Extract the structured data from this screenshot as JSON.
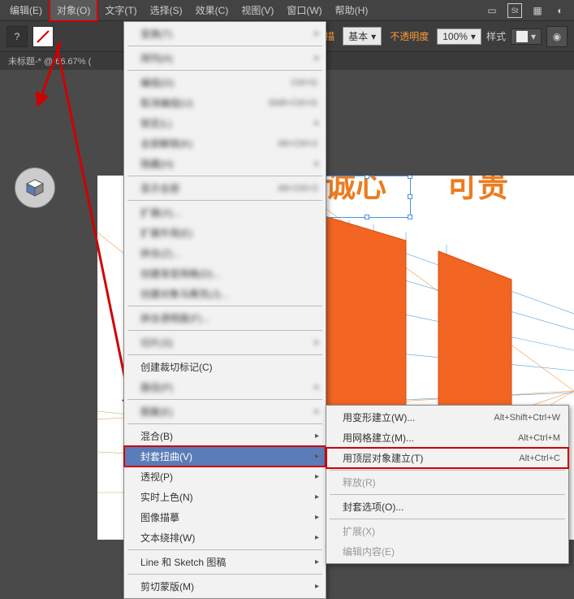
{
  "menubar": {
    "items": [
      {
        "label": "编辑(E)"
      },
      {
        "label": "对象(O)"
      },
      {
        "label": "文字(T)"
      },
      {
        "label": "选择(S)"
      },
      {
        "label": "效果(C)"
      },
      {
        "label": "视图(V)"
      },
      {
        "label": "窗口(W)"
      },
      {
        "label": "帮助(H)"
      }
    ]
  },
  "toolbar": {
    "stroke_label": "描",
    "basic_label": "基本",
    "opacity_label": "不透明度",
    "opacity_value": "100%",
    "style_label": "样式"
  },
  "doc": {
    "title": "未标题-* @ 66.67%  ("
  },
  "canvas_text": {
    "t1": "诚心",
    "t2": "可贵"
  },
  "dropdown": {
    "items": [
      {
        "label": "变换(T)",
        "sub": true,
        "blur": true
      },
      {
        "label": "排列(A)",
        "sub": true,
        "blur": true
      },
      {
        "label": "编组(G)",
        "shortcut": "Ctrl+G",
        "blur": true
      },
      {
        "label": "取消编组(U)",
        "shortcut": "Shift+Ctrl+G",
        "blur": true
      },
      {
        "label": "锁定(L)",
        "sub": true,
        "blur": true
      },
      {
        "label": "全部解锁(K)",
        "shortcut": "Alt+Ctrl+2",
        "blur": true
      },
      {
        "label": "隐藏(H)",
        "sub": true,
        "blur": true
      },
      {
        "label": "显示全部",
        "shortcut": "Alt+Ctrl+3",
        "blur": true
      },
      {
        "label": "扩展(X)...",
        "blur": true
      },
      {
        "label": "扩展外观(E)",
        "blur": true
      },
      {
        "label": "拼合(Z)...",
        "blur": true
      },
      {
        "label": "创建渐变网格(D)...",
        "blur": true
      },
      {
        "label": "创建对象马赛克(J)...",
        "blur": true
      },
      {
        "label": "拼合透明度(F)...",
        "blur": true
      },
      {
        "label": "切片(S)",
        "sub": true,
        "blur": true
      },
      {
        "label": "创建裁切标记(C)"
      },
      {
        "label": "路径(P)",
        "sub": true,
        "blur": true
      },
      {
        "label": "图案(E)",
        "sub": true,
        "blur": true
      },
      {
        "label": "混合(B)",
        "sub": true
      },
      {
        "label": "封套扭曲(V)",
        "sub": true,
        "highlight": true,
        "red": true
      },
      {
        "label": "透视(P)",
        "sub": true
      },
      {
        "label": "实时上色(N)",
        "sub": true
      },
      {
        "label": "图像描摹",
        "sub": true
      },
      {
        "label": "文本绕排(W)",
        "sub": true
      },
      {
        "label": "Line 和 Sketch 图稿",
        "sub": true
      },
      {
        "label": "剪切蒙版(M)",
        "sub": true
      }
    ]
  },
  "submenu": {
    "items": [
      {
        "label": "用变形建立(W)...",
        "shortcut": "Alt+Shift+Ctrl+W"
      },
      {
        "label": "用网格建立(M)...",
        "shortcut": "Alt+Ctrl+M"
      },
      {
        "label": "用顶层对象建立(T)",
        "shortcut": "Alt+Ctrl+C",
        "red": true
      },
      {
        "label": "释放(R)",
        "disabled": true
      },
      {
        "label": "封套选项(O)..."
      },
      {
        "label": "扩展(X)",
        "disabled": true
      },
      {
        "label": "编辑内容(E)",
        "disabled": true
      }
    ]
  }
}
